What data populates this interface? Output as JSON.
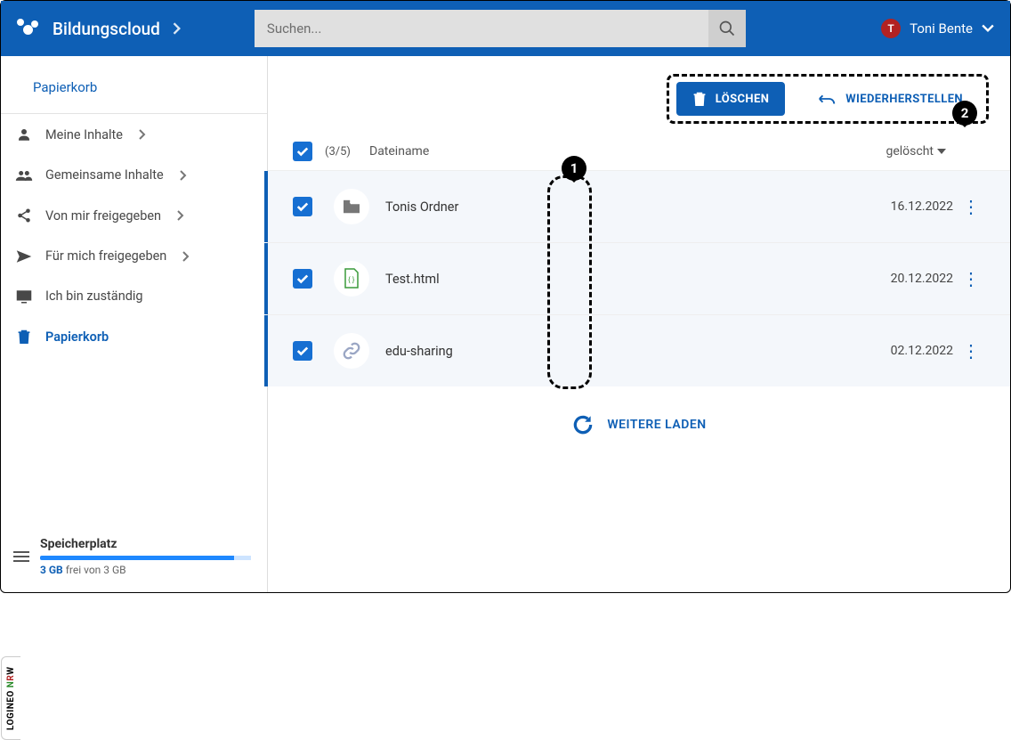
{
  "header": {
    "brand": "Bildungscloud",
    "search_placeholder": "Suchen...",
    "user_initial": "T",
    "user_name": "Toni Bente"
  },
  "page": {
    "title": "Papierkorb"
  },
  "sidebar": {
    "items": [
      {
        "label": "Meine Inhalte",
        "icon": "user",
        "chev": true
      },
      {
        "label": "Gemeinsame Inhalte",
        "icon": "group",
        "chev": true
      },
      {
        "label": "Von mir freigegeben",
        "icon": "share",
        "chev": true
      },
      {
        "label": "Für mich freigegeben",
        "icon": "send",
        "chev": true
      },
      {
        "label": "Ich bin zuständig",
        "icon": "monitor",
        "chev": false
      },
      {
        "label": "Papierkorb",
        "icon": "trash",
        "chev": false,
        "active": true
      }
    ]
  },
  "vtab": "LOGINEO NRW",
  "storage": {
    "title": "Speicherplatz",
    "used": "3 GB",
    "rest": "frei von 3 GB"
  },
  "actions": {
    "delete": "LÖSCHEN",
    "restore": "WIEDERHERSTELLEN"
  },
  "annotations": {
    "col": "1",
    "actions": "2"
  },
  "table": {
    "count_label": "(3/5)",
    "col_name": "Dateiname",
    "col_deleted": "gelöscht",
    "rows": [
      {
        "name": "Tonis Ordner",
        "date": "16.12.2022",
        "icon": "folder"
      },
      {
        "name": "Test.html",
        "date": "20.12.2022",
        "icon": "html"
      },
      {
        "name": "edu-sharing",
        "date": "02.12.2022",
        "icon": "link"
      }
    ],
    "load_more": "WEITERE LADEN"
  }
}
